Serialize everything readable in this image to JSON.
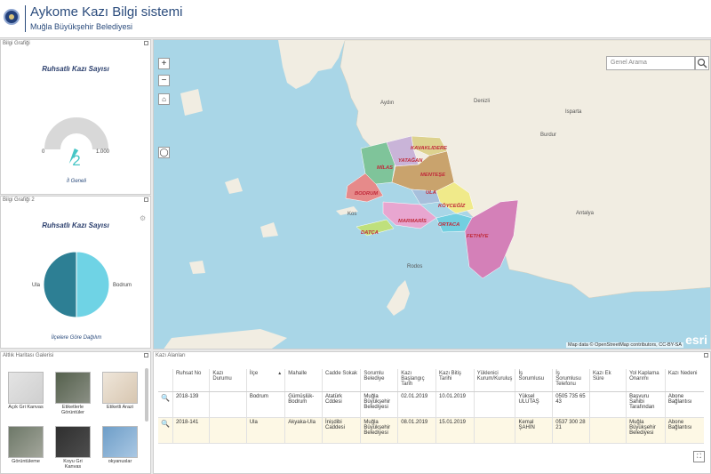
{
  "header": {
    "title": "Aykome Kazı Bilgi sistemi",
    "subtitle": "Muğla Büyükşehir Belediyesi"
  },
  "gauge_panel": {
    "panel_title": "Bilgi Grafiği",
    "chart_title": "Ruhsatlı Kazı Sayısı",
    "min_label": "0",
    "max_label": "1.000",
    "value_label": "2",
    "footer": "İl Geneli"
  },
  "pie_panel": {
    "panel_title": "Bilgi Grafiği 2",
    "chart_title": "Ruhsatlı Kazı Sayısı",
    "footer": "İlçelere Göre Dağılım"
  },
  "chart_data": [
    {
      "type": "gauge",
      "title": "Ruhsatlı Kazı Sayısı",
      "value": 2,
      "min": 0,
      "max": 1000,
      "label": "İl Geneli"
    },
    {
      "type": "pie",
      "title": "Ruhsatlı Kazı Sayısı",
      "categories": [
        "Ula",
        "Bodrum"
      ],
      "values": [
        1,
        1
      ],
      "colors": [
        "#2d7f94",
        "#6fd3e5"
      ],
      "label": "İlçelere Göre Dağılım"
    }
  ],
  "map": {
    "search_placeholder": "Genel Arama",
    "attribution": "Map data © OpenStreetMap contributors, CC-BY-SA",
    "esri_logo": "esri",
    "zoom_in": "+",
    "zoom_out": "−",
    "districts": [
      "KAVAKLIDERE",
      "YATAĞAN",
      "MİLAS",
      "MENTEŞE",
      "BODRUM",
      "ULA",
      "KÖYCEĞİZ",
      "MARMARİS",
      "ORTACA",
      "DATÇA",
      "FETHİYE"
    ],
    "cities": [
      "Aydın",
      "Isparta",
      "Antalya",
      "Burdur",
      "Denizli",
      "Rodos",
      "Kos"
    ]
  },
  "gallery": {
    "panel_title": "Altlık Haritası Galerisi",
    "items": [
      {
        "label": "Açık Gri Kanvas"
      },
      {
        "label": "Etiketlerle Görüntüler"
      },
      {
        "label": "Etiketli Arazi"
      },
      {
        "label": "Görüntüleme"
      },
      {
        "label": "Koyu Gri Kanvas"
      },
      {
        "label": "okyanuslar"
      }
    ]
  },
  "table": {
    "panel_title": "Kazı Alanları",
    "columns": [
      "Ruhsat No",
      "Kazı Durumu",
      "İlçe",
      "Mahalle",
      "Cadde Sokak",
      "Sorumlu Belediye",
      "Kazı Başlangıç Tarih",
      "Kazı Bitiş Tarihi",
      "Yüklenici Kurum/Kuruluş",
      "İş Sorumlusu",
      "İş Sorumlusu Telefonu",
      "Kazı Ek Süre",
      "Yol Kaplama Onarımı",
      "Kazı Nedeni"
    ],
    "rows": [
      [
        "2018-139",
        "",
        "Bodrum",
        "Gümüşlük-Bodrum",
        "Atatürk Cddesi",
        "Muğla Büyükşehir Belediyesi",
        "02.01.2019",
        "10.01.2019",
        "",
        "Yüksel ULUTAŞ",
        "0505 735 65 43",
        "",
        "Başvuru Sahibi Tarafından",
        "Abone Bağlantısı"
      ],
      [
        "2018-141",
        "",
        "Ula",
        "Akyaka-Ula",
        "İnişdibi Caddesi",
        "Muğla Büyükşehir Belediyesi",
        "08.01.2019",
        "15.01.2019",
        "",
        "Kemal ŞAHİN",
        "0537 300 28 21",
        "",
        "Muğla Büyükşehir Belediyesi",
        "Abone Bağlantısı"
      ]
    ]
  }
}
